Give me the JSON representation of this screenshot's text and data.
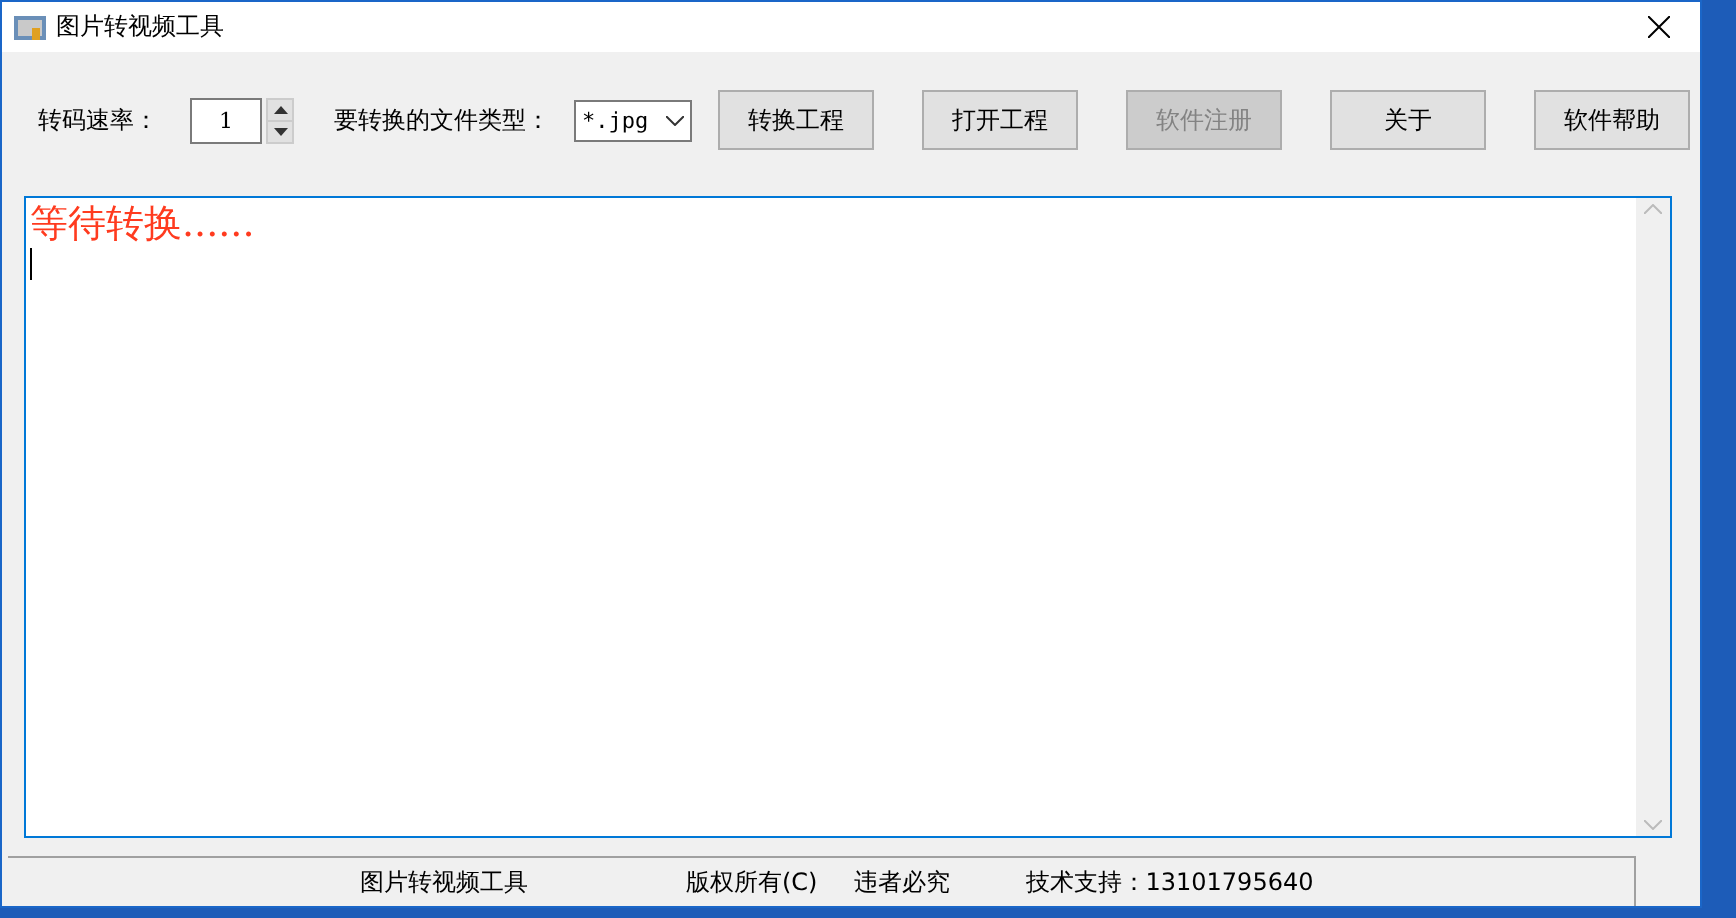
{
  "window": {
    "title": "图片转视频工具"
  },
  "toolbar": {
    "rate_label": "转码速率：",
    "rate_value": "1",
    "type_label": "要转换的文件类型：",
    "type_value": "*.jpg",
    "buttons": [
      {
        "label": "转换工程",
        "disabled": false
      },
      {
        "label": "打开工程",
        "disabled": false
      },
      {
        "label": "软件注册",
        "disabled": true
      },
      {
        "label": "关于",
        "disabled": false
      },
      {
        "label": "软件帮助",
        "disabled": false
      }
    ]
  },
  "output": {
    "text": "等待转换......"
  },
  "status_bar": [
    "图片转视频工具",
    "版权所有(C)",
    "违者必究",
    "技术支持：13101795640"
  ]
}
